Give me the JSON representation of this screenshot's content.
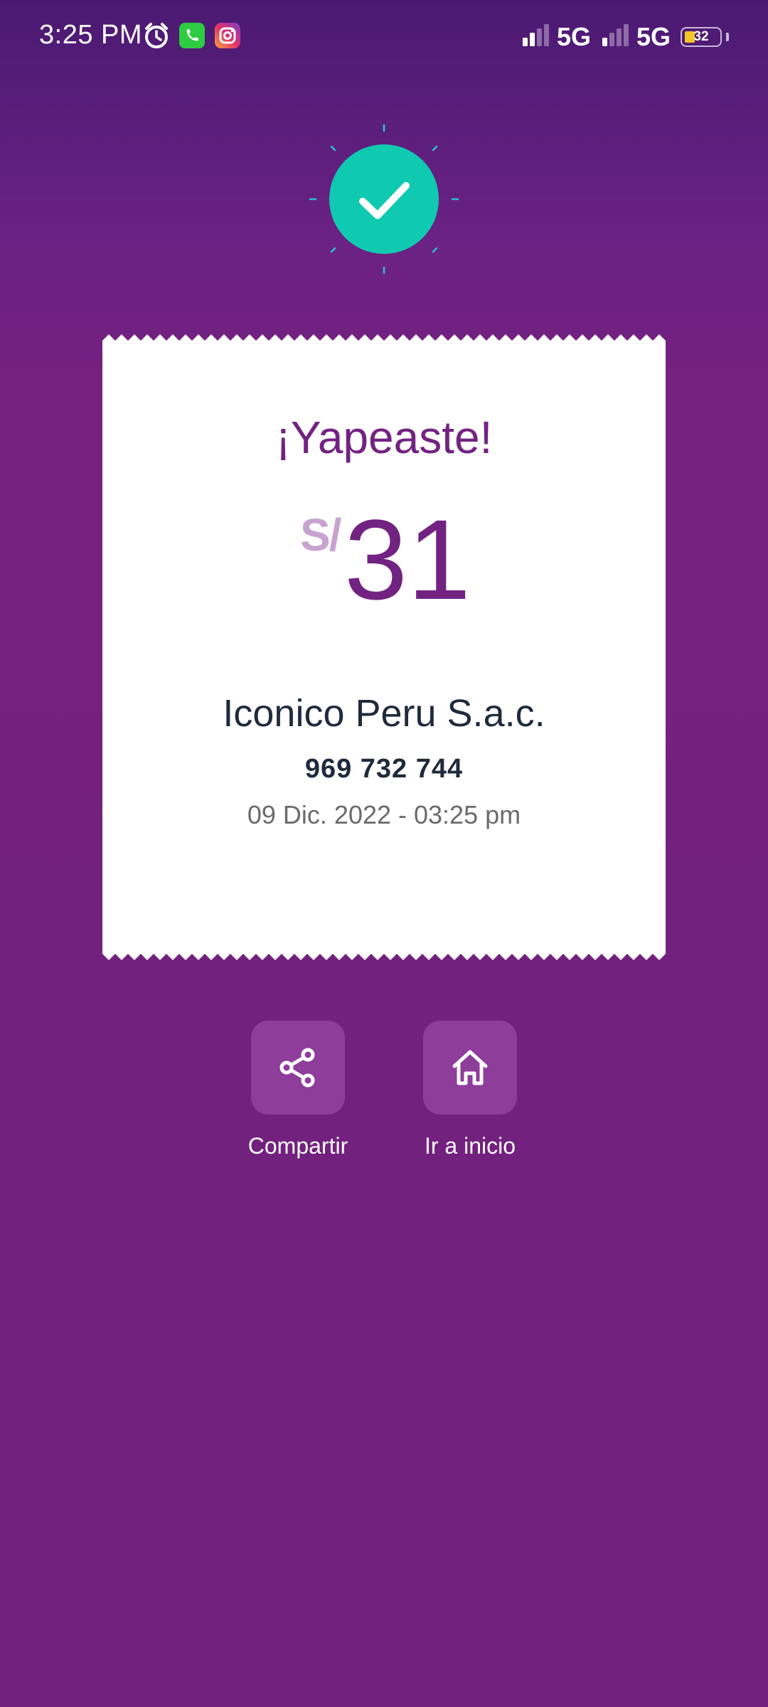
{
  "status_bar": {
    "time": "3:25 PM",
    "icons": [
      "alarm-icon",
      "whatsapp-icon",
      "instagram-icon"
    ],
    "network_1": "5G",
    "network_2": "5G",
    "battery_level": "32",
    "battery_color": "#f3c623"
  },
  "success": {
    "icon": "checkmark-icon",
    "color": "#10c9b1"
  },
  "receipt": {
    "title": "¡Yapeaste!",
    "currency": "S/",
    "amount": "31",
    "recipient": "Iconico Peru S.a.c.",
    "phone": "969 732 744",
    "datetime": "09 Dic. 2022 - 03:25 pm"
  },
  "actions": {
    "share_label": "Compartir",
    "home_label": "Ir a inicio"
  },
  "colors": {
    "brand_purple": "#722381",
    "accent_teal": "#10c9b1"
  }
}
